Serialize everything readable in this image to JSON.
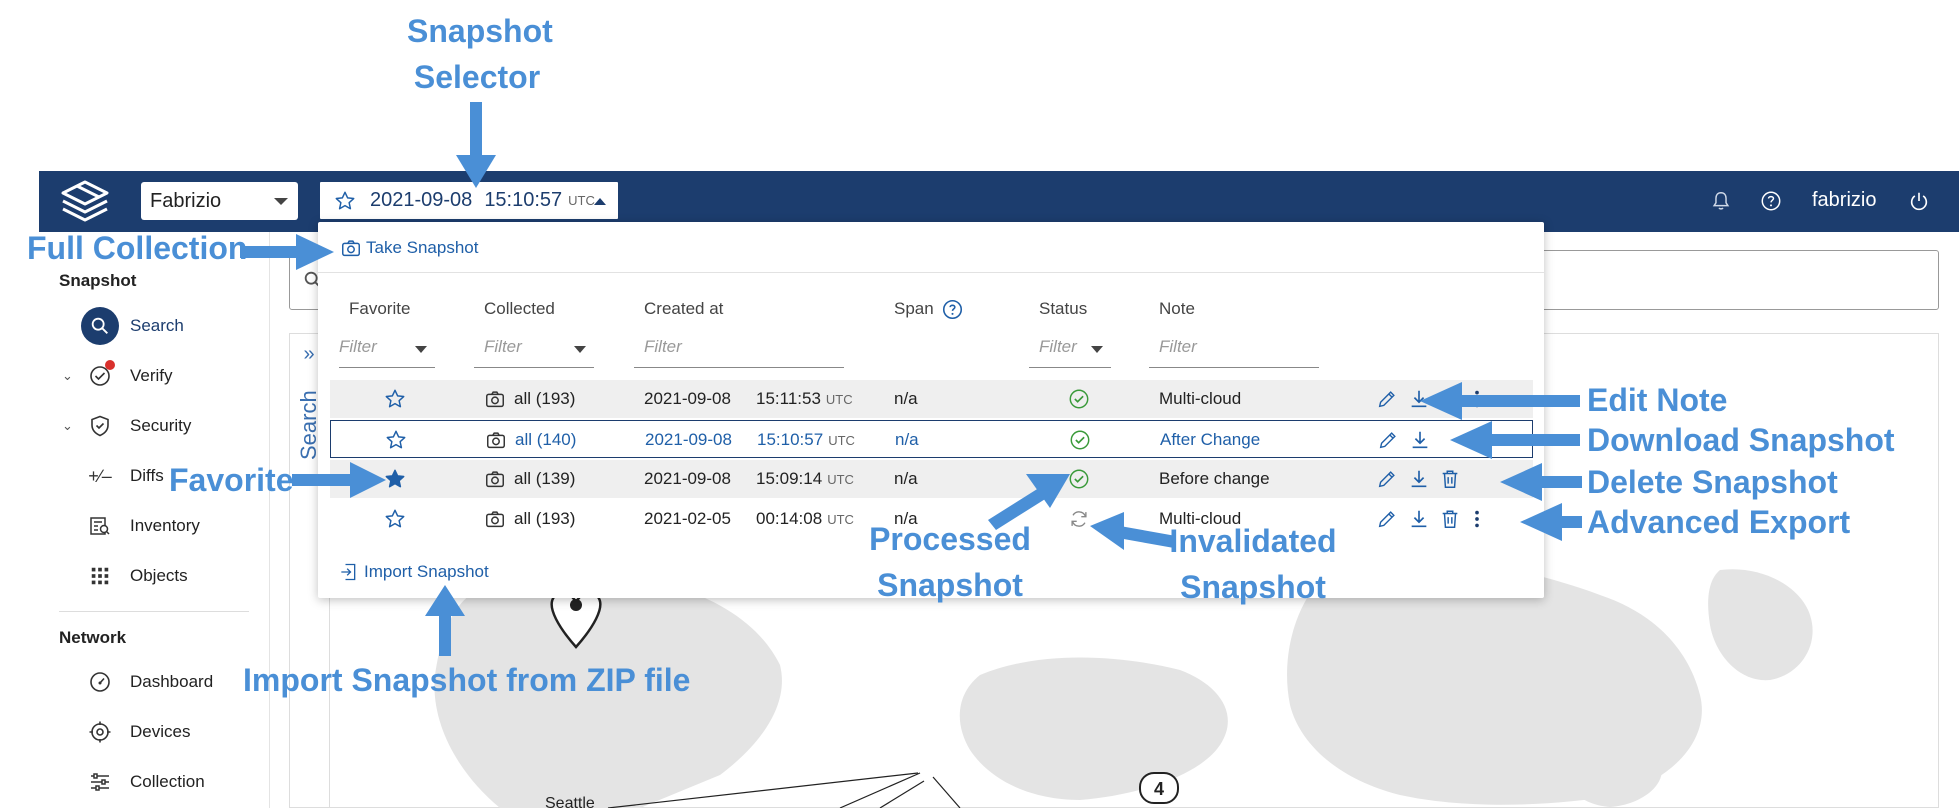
{
  "header": {
    "network_selector": "Fabrizio",
    "snapshot_selector": {
      "date": "2021-09-08",
      "time": "15:10:57",
      "tz": "UTC"
    },
    "username": "fabrizio"
  },
  "sidebar": {
    "sections": [
      {
        "title": "Snapshot",
        "items": [
          "Search",
          "Verify",
          "Security",
          "Diffs",
          "Inventory",
          "Objects"
        ]
      },
      {
        "title": "Network",
        "items": [
          "Dashboard",
          "Devices",
          "Collection"
        ]
      }
    ]
  },
  "map": {
    "collapse_icon": "»",
    "search_label": "Search",
    "city_label": "Seattle",
    "cluster_count": "4"
  },
  "snapshot_panel": {
    "take_snapshot": "Take Snapshot",
    "import_snapshot": "Import Snapshot",
    "columns": {
      "favorite": "Favorite",
      "collected": "Collected",
      "created_at": "Created at",
      "span": "Span",
      "status": "Status",
      "note": "Note"
    },
    "filter_placeholder": "Filter",
    "rows": [
      {
        "favorite": false,
        "collected": "all (193)",
        "date": "2021-09-08",
        "time": "15:11:53",
        "tz": "UTC",
        "span": "n/a",
        "status": "processed",
        "note": "Multi-cloud"
      },
      {
        "favorite": false,
        "collected": "all (140)",
        "date": "2021-09-08",
        "time": "15:10:57",
        "tz": "UTC",
        "span": "n/a",
        "status": "processed",
        "note": "After Change"
      },
      {
        "favorite": true,
        "collected": "all (139)",
        "date": "2021-09-08",
        "time": "15:09:14",
        "tz": "UTC",
        "span": "n/a",
        "status": "processed",
        "note": "Before change"
      },
      {
        "favorite": false,
        "collected": "all (193)",
        "date": "2021-02-05",
        "time": "00:14:08",
        "tz": "UTC",
        "span": "n/a",
        "status": "invalidated",
        "note": "Multi-cloud"
      }
    ]
  },
  "annotations": {
    "snapshot_selector_line1": "Snapshot",
    "snapshot_selector_line2": "Selector",
    "full_collection": "Full Collection",
    "favorite": "Favorite",
    "edit_note": "Edit Note",
    "download_snapshot": "Download Snapshot",
    "delete_snapshot": "Delete Snapshot",
    "advanced_export": "Advanced Export",
    "processed_line1": "Processed",
    "processed_line2": "Snapshot",
    "invalidated_line1": "Invalidated",
    "invalidated_line2": "Snapshot",
    "import_zip": "Import Snapshot from ZIP file"
  },
  "colors": {
    "topbar": "#1c3d6e",
    "accent_link": "#1f5fa8",
    "annotation": "#4a8fd6",
    "status_ok": "#3a9a3a"
  }
}
